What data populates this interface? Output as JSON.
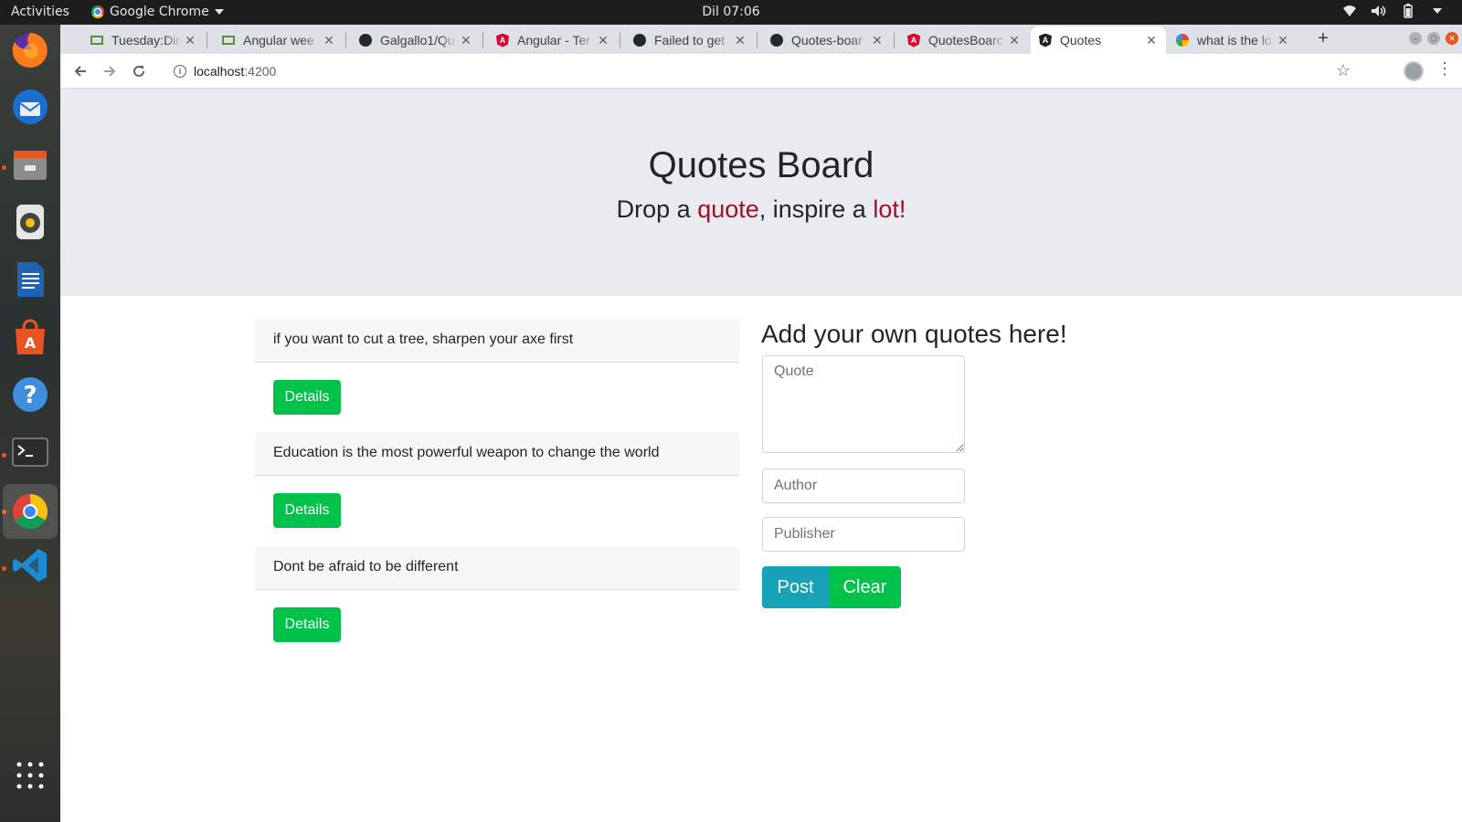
{
  "topbar": {
    "activities": "Activities",
    "app_name": "Google Chrome",
    "clock": "Dil 07:06",
    "tray_icons": [
      "wifi-icon",
      "volume-icon",
      "battery-icon",
      "power-menu-arrow-icon"
    ]
  },
  "dock": {
    "apps": [
      {
        "name": "firefox",
        "running": false
      },
      {
        "name": "thunderbird",
        "running": false
      },
      {
        "name": "files",
        "running": true
      },
      {
        "name": "rhythmbox",
        "running": false
      },
      {
        "name": "libreoffice-writer",
        "running": false
      },
      {
        "name": "software-center",
        "running": false
      },
      {
        "name": "help",
        "running": false
      },
      {
        "name": "terminal",
        "running": true
      },
      {
        "name": "chrome",
        "running": true
      },
      {
        "name": "vscode",
        "running": true
      },
      {
        "name": "show-applications",
        "running": false
      }
    ]
  },
  "browser": {
    "tabs": [
      {
        "title": "Tuesday:Dire",
        "favicon": "gmail-icon"
      },
      {
        "title": "Angular wee",
        "favicon": "gmail-icon"
      },
      {
        "title": "Galgallo1/Qu",
        "favicon": "github-icon"
      },
      {
        "title": "Angular - Ter",
        "favicon": "angular-icon"
      },
      {
        "title": "Failed to get",
        "favicon": "github-icon"
      },
      {
        "title": "Quotes-boar",
        "favicon": "github-icon"
      },
      {
        "title": "QuotesBoarc",
        "favicon": "angular-icon"
      },
      {
        "title": "Quotes",
        "favicon": "angular-dark-icon",
        "active": true
      },
      {
        "title": "what is the lo",
        "favicon": "google-icon"
      }
    ],
    "new_tab_label": "+",
    "url_host": "localhost",
    "url_port": ":4200"
  },
  "page": {
    "title": "Quotes Board",
    "subtitle": {
      "p1": "Drop a ",
      "w1": "quote",
      "p2": ", inspire a ",
      "w2": "lot!"
    },
    "quotes": [
      {
        "text": "if you want to cut a tree, sharpen your axe first",
        "button": "Details"
      },
      {
        "text": "Education is the most powerful weapon to change the world",
        "button": "Details"
      },
      {
        "text": "Dont be afraid to be different",
        "button": "Details"
      }
    ],
    "form": {
      "heading": "Add your own quotes here!",
      "quote_placeholder": "Quote",
      "author_placeholder": "Author",
      "publisher_placeholder": "Publisher",
      "post_label": "Post",
      "clear_label": "Clear"
    }
  },
  "colors": {
    "accent_red": "#a0102b",
    "details_green": "#00c14a",
    "post_teal": "#17a2b8",
    "jumbotron_bg": "#e9ecef"
  }
}
